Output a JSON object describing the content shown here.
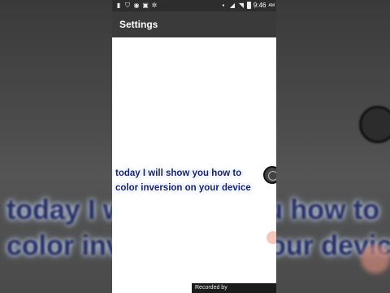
{
  "status_bar": {
    "time": "9:46",
    "time_suffix": "AM",
    "left_icons": [
      "sim-icon",
      "shield-icon",
      "messenger-icon",
      "gallery-icon",
      "settings-icon"
    ],
    "right_icons": [
      "signal-icon",
      "wifi-icon",
      "notification-icon",
      "battery-icon"
    ]
  },
  "app_bar": {
    "title": "Settings"
  },
  "caption": {
    "line1": "today I will show you how to",
    "line2": "color inversion on your device"
  },
  "recorder": {
    "label": "Recorded by"
  }
}
